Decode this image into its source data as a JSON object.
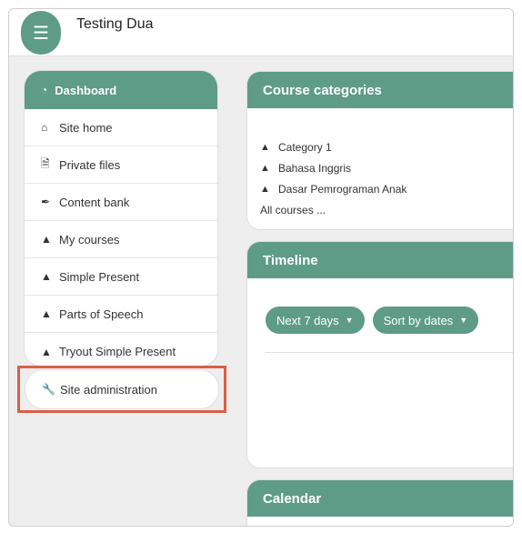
{
  "header": {
    "menu_icon": "hamburger-icon",
    "site_title": "Testing Dua"
  },
  "nav": {
    "dashboard_label": "Dashboard",
    "items": [
      {
        "label": "Site home",
        "icon": "home-icon"
      },
      {
        "label": "Private files",
        "icon": "file-icon"
      },
      {
        "label": "Content bank",
        "icon": "brush-icon"
      },
      {
        "label": "My courses",
        "icon": "graduation-cap-icon"
      },
      {
        "label": "Simple Present",
        "icon": "graduation-cap-icon"
      },
      {
        "label": "Parts of Speech",
        "icon": "graduation-cap-icon"
      },
      {
        "label": "Tryout Simple Present",
        "icon": "graduation-cap-icon"
      }
    ],
    "site_admin_label": "Site administration"
  },
  "course_categories": {
    "title": "Course categories",
    "categories": [
      "Category 1",
      "Bahasa Inggris",
      "Dasar Pemrograman Anak"
    ],
    "all_courses": "All courses ..."
  },
  "timeline": {
    "title": "Timeline",
    "range_filter": "Next 7 days",
    "sort_filter": "Sort by dates"
  },
  "calendar": {
    "title": "Calendar"
  },
  "colors": {
    "accent": "#5e9c88",
    "highlight": "#d9604a"
  }
}
